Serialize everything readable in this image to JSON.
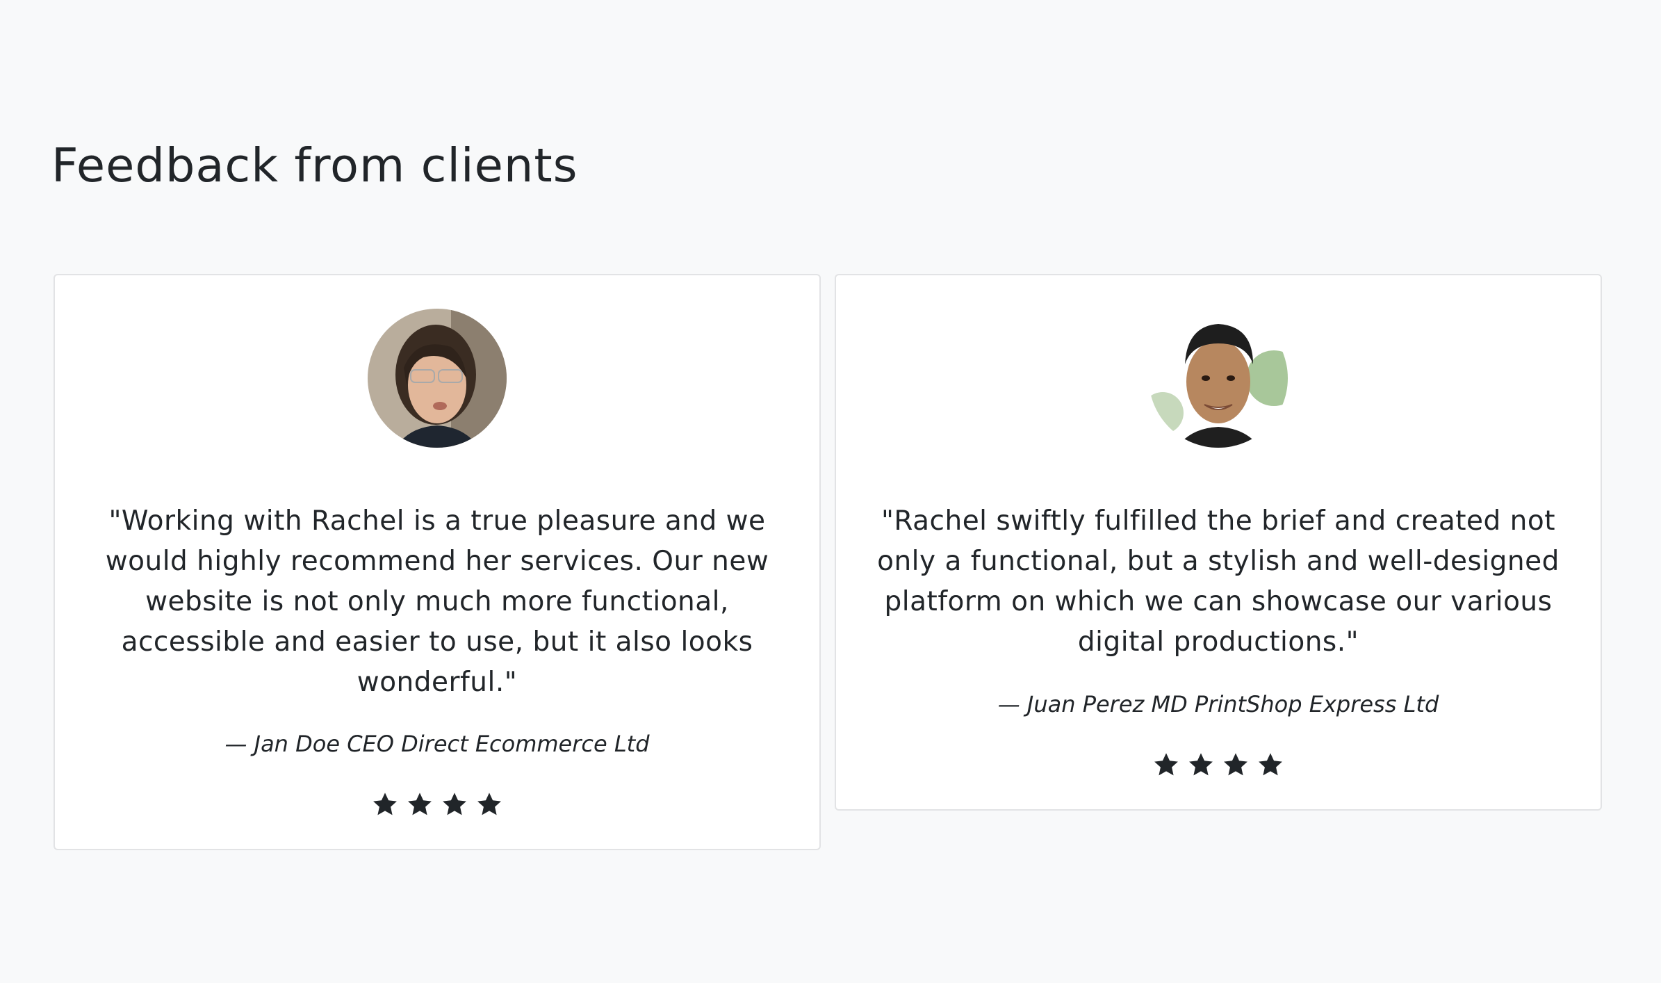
{
  "section": {
    "title": "Feedback from clients"
  },
  "testimonials": [
    {
      "quote": "\"Working with Rachel is a true pleasure and we would highly recommend her services. Our new website is not only much more functional, accessible and easier to use, but it also looks wonderful.\"",
      "author": "— Jan Doe CEO Direct Ecommerce Ltd",
      "rating": 4
    },
    {
      "quote": "\"Rachel swiftly fulfilled the brief and created not only a functional, but a stylish and well-designed platform on which we can showcase our various digital productions.\"",
      "author": "— Juan Perez MD PrintShop Express Ltd",
      "rating": 4
    }
  ],
  "icons": {
    "rating": "star-icon",
    "photo": "avatar"
  },
  "colors": {
    "background": "#f8f9fa",
    "card": "#ffffff",
    "text": "#212529",
    "border": "#e2e3e5"
  }
}
